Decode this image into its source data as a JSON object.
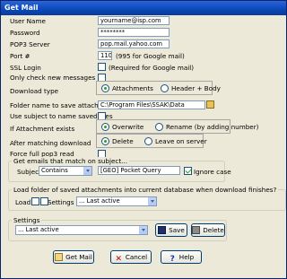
{
  "window": {
    "title": "Get Mail"
  },
  "fields": {
    "user_name_label": "User Name",
    "user_name_value": "yourname@isp.com",
    "password_label": "Password",
    "password_value": "********",
    "pop3_label": "POP3 Server",
    "pop3_value": "pop.mail.yahoo.com",
    "port_label": "Port #",
    "port_value": "110",
    "port_hint": "(995 for Google mail)",
    "ssl_label": "SSL Login",
    "ssl_hint": "(Required for Google mail)",
    "only_check_label": "Only check new messages"
  },
  "download_type": {
    "label": "Download type",
    "options": [
      "Attachments",
      "Header + Body"
    ],
    "selected": "Attachments"
  },
  "folder": {
    "label": "Folder name to save attachments",
    "value": "C:\\Program Files\\SSAK\\Data"
  },
  "use_subject_label": "Use subject to name saved files",
  "if_exists": {
    "label": "If Attachment exists",
    "options": [
      "Overwrite",
      "Rename (by adding number)"
    ],
    "selected": "Overwrite"
  },
  "after_download": {
    "label": "After matching download",
    "options": [
      "Delete",
      "Leave on server"
    ],
    "selected": "Delete"
  },
  "force_pop3_label": "Force full pop3 read",
  "subject_group": {
    "title": "Get emails that match on subject...",
    "subject_label": "Subject",
    "match_value": "Contains",
    "query_value": "[GEO] Pocket Query",
    "ignore_case_label": "Ignore case"
  },
  "load_group": {
    "title": "Load folder of saved attachments into current database when download finishes?",
    "load_label": "Load",
    "settings_label": "Settings",
    "settings_value": "... Last active"
  },
  "settings_group": {
    "title": "Settings",
    "value": "... Last active",
    "save_label": "Save",
    "delete_label": "Delete"
  },
  "buttons": {
    "get_mail": "Get Mail",
    "cancel": "Cancel",
    "help": "Help"
  }
}
